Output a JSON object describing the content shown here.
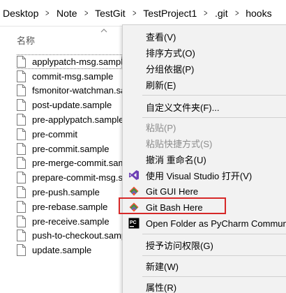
{
  "breadcrumb": [
    "Desktop",
    "Note",
    "TestGit",
    "TestProject1",
    ".git",
    "hooks"
  ],
  "list": {
    "column_header": "名称",
    "files": [
      "applypatch-msg.sample",
      "commit-msg.sample",
      "fsmonitor-watchman.sample",
      "post-update.sample",
      "pre-applypatch.sample",
      "pre-commit",
      "pre-commit.sample",
      "pre-merge-commit.sample",
      "prepare-commit-msg.sample",
      "pre-push.sample",
      "pre-rebase.sample",
      "pre-receive.sample",
      "push-to-checkout.sample",
      "update.sample"
    ]
  },
  "menu": {
    "view": "查看(V)",
    "sort": "排序方式(O)",
    "group": "分组依据(P)",
    "refresh": "刷新(E)",
    "customize": "自定义文件夹(F)...",
    "paste": "粘贴(P)",
    "paste_shortcut": "粘贴快捷方式(S)",
    "undo_rename": "撤消 重命名(U)",
    "open_vs": "使用 Visual Studio 打开(V)",
    "git_gui": "Git GUI Here",
    "git_bash": "Git Bash Here",
    "pycharm": "Open Folder as PyCharm Community",
    "grant_access": "授予访问权限(G)",
    "new": "新建(W)",
    "properties": "属性(R)"
  },
  "colors": {
    "highlight_border": "#d62828",
    "menu_background": "#f2f2f2",
    "vs_purple": "#6c3fb5",
    "git_orange": "#f05133"
  }
}
